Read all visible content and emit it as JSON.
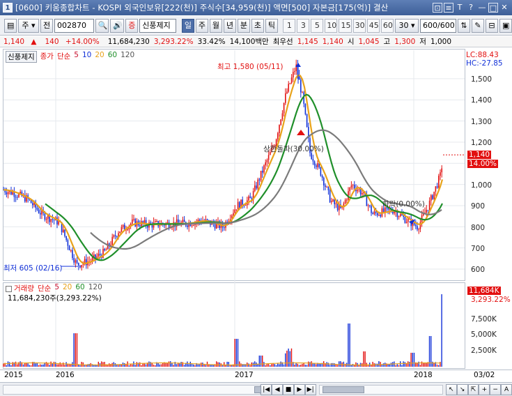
{
  "window": {
    "icon_label": "1",
    "title": "[0600] 키움종합차트 - KOSPI 외국인보유[222(천)] 주식수[34,959(천)] 액면[500] 자본금[175(억)] 결산",
    "buttons": [
      "⊡",
      "≡",
      "T",
      "?",
      "—",
      "□",
      "✕"
    ]
  },
  "toolbar": {
    "menu_label": "▤",
    "type_select": "주",
    "prev_label": "전",
    "code_input": "002870",
    "search_icon": "🔍",
    "audio_icon": "🔊",
    "zeung_label": "증",
    "stock_name": "신풍제지",
    "period_active": "일",
    "periods": [
      "주",
      "월",
      "년",
      "분",
      "초",
      "틱"
    ],
    "intervals": [
      "1",
      "3",
      "5",
      "10",
      "15",
      "30",
      "45",
      "60"
    ],
    "interval_select": "30",
    "count_display": "600/600",
    "right_icons": [
      "⇅",
      "✎",
      "⊟",
      "▣"
    ]
  },
  "info": {
    "price": "1,140",
    "change_arrow": "▲",
    "change": "140",
    "change_rate": "+14.00%",
    "volume": "11,684,230",
    "volume_rate": "3,293.22%",
    "turnover": "33.42%",
    "amount": "14,100백만",
    "priority_label": "최우선",
    "best_ask": "1,145",
    "best_bid": "1,140",
    "open_label": "시",
    "open": "1,045",
    "high_label": "고",
    "high": "1,300",
    "low_label": "저",
    "low": "1,000"
  },
  "price_panel": {
    "stock_box": "신풍제지",
    "legend": [
      "종가",
      "단순",
      "5",
      "10",
      "20",
      "60",
      "120"
    ],
    "lc": "LC:88.43",
    "hc": "HC:-27.85",
    "current_tag": "1,140",
    "current_rate": "14.00%",
    "y_ticks": [
      "1,500",
      "1,400",
      "1,300",
      "1,200",
      "1,100",
      "1,000",
      "900",
      "800",
      "700",
      "600"
    ],
    "max_label": "최고 1,580 (05/11)",
    "min_label": "최저 605 (02/16)",
    "annot_1": "상한돌파(30.00%)",
    "annot_2": "하락(0.00%)"
  },
  "volume_panel": {
    "legend": [
      "거래량",
      "단순",
      "5",
      "20",
      "60",
      "120"
    ],
    "sub_legend": "11,684,230주(3,293.22%)",
    "current_tag": "11,684K",
    "current_rate": "3,293.22%",
    "y_ticks": [
      "7,500K",
      "5,000K",
      "2,500K"
    ]
  },
  "x_axis": {
    "labels": [
      "2015",
      "2016",
      "2017",
      "2018",
      "03/02"
    ]
  },
  "scroll": {
    "buttons": [
      "|◀",
      "◀",
      "■",
      "▶",
      "▶|"
    ],
    "right_buttons": [
      "↖",
      "↘",
      "⇱",
      "+",
      "−",
      "A"
    ]
  },
  "colors": {
    "up": "#e21010",
    "down": "#1130d8",
    "ma5": "#e8a21a",
    "ma20": "#1f8f2a",
    "ma60": "#7b7b7b"
  }
}
